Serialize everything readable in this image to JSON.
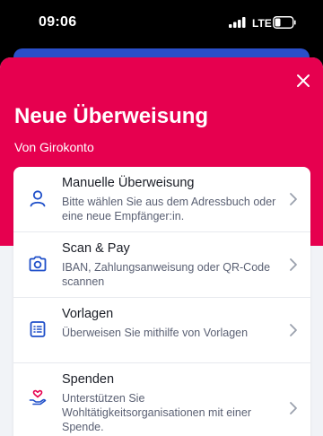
{
  "status_bar": {
    "time": "09:06",
    "network": "LTE"
  },
  "sheet": {
    "title": "Neue Überweisung",
    "subtitle": "Von Girokonto"
  },
  "options": [
    {
      "icon": "person-icon",
      "title": "Manuelle Überweisung",
      "description": "Bitte wählen Sie aus dem Adressbuch oder eine neue Empfänger:in."
    },
    {
      "icon": "camera-icon",
      "title": "Scan & Pay",
      "description": "IBAN, Zahlungsanweisung oder QR-Code scannen"
    },
    {
      "icon": "list-icon",
      "title": "Vorlagen",
      "description": "Überweisen Sie mithilfe von Vorlagen"
    },
    {
      "icon": "donation-heart-icon",
      "title": "Spenden",
      "description": "Unterstützen Sie Wohltätigkeitsorganisationen mit einer Spende."
    }
  ],
  "colors": {
    "brand": "#e6004f",
    "icon_blue": "#1f4fc9"
  }
}
